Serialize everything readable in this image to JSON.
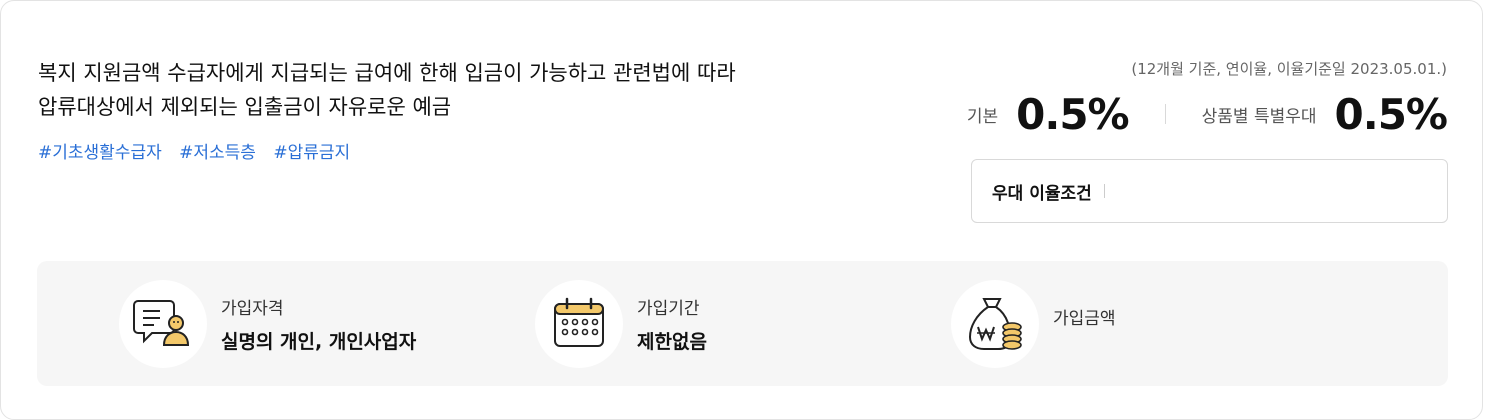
{
  "product": {
    "description_line1": "복지 지원금액 수급자에게 지급되는 급여에 한해 입금이 가능하고 관련법에 따라",
    "description_line2": "압류대상에서 제외되는 입출금이 자유로운 예금",
    "tags": [
      "#기초생활수급자",
      "#저소득층",
      "#압류금지"
    ]
  },
  "rates": {
    "note": "(12개월 기준, 연이율, 이율기준일 2023.05.01.)",
    "base_label": "기본",
    "base_value": "0.5%",
    "special_label": "상품별 특별우대",
    "special_value": "0.5%"
  },
  "condition": {
    "label": "우대 이율조건"
  },
  "info": {
    "eligibility": {
      "title": "가입자격",
      "value": "실명의 개인, 개인사업자",
      "icon": "person-document-icon"
    },
    "period": {
      "title": "가입기간",
      "value": "제한없음",
      "icon": "calendar-icon"
    },
    "amount": {
      "title": "가입금액",
      "value": "",
      "icon": "money-bag-icon"
    }
  },
  "colors": {
    "accent": "#2a6fd6",
    "panel": "#f6f6f6",
    "icon_yellow": "#f3c86a"
  }
}
